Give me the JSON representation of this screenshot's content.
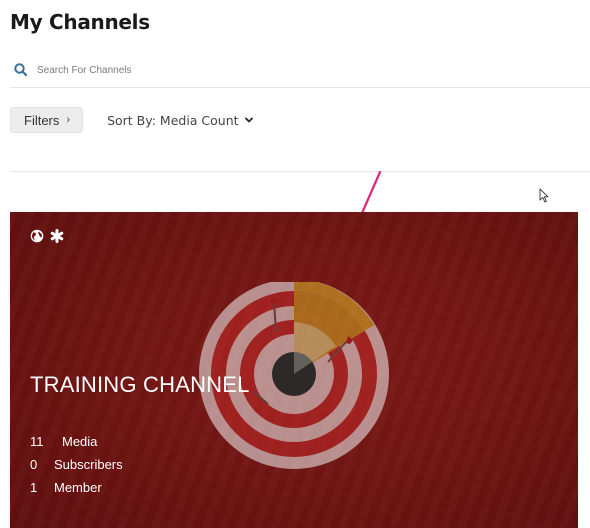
{
  "page": {
    "title": "My Channels"
  },
  "search": {
    "placeholder": "Search For Channels",
    "value": ""
  },
  "controls": {
    "filters_label": "Filters",
    "sort_label": "Sort By: Media Count"
  },
  "icons": {
    "search": "search-icon",
    "filters_chevron": "chevron-right-icon",
    "sort_caret": "chevron-down-icon",
    "card_public": "globe-icon",
    "card_featured": "asterisk-icon",
    "cursor": "mouse-pointer-icon",
    "annotation": "arrow-icon"
  },
  "colors": {
    "card_bg": "#6e1412",
    "annotation_arrow": "#e0257a",
    "search_icon": "#3a6f9a"
  },
  "channel_card": {
    "title": "TRAINING CHANNEL",
    "stats": [
      {
        "count": "11",
        "label": "Media"
      },
      {
        "count": "0",
        "label": "Subscribers"
      },
      {
        "count": "1",
        "label": "Member"
      }
    ]
  }
}
